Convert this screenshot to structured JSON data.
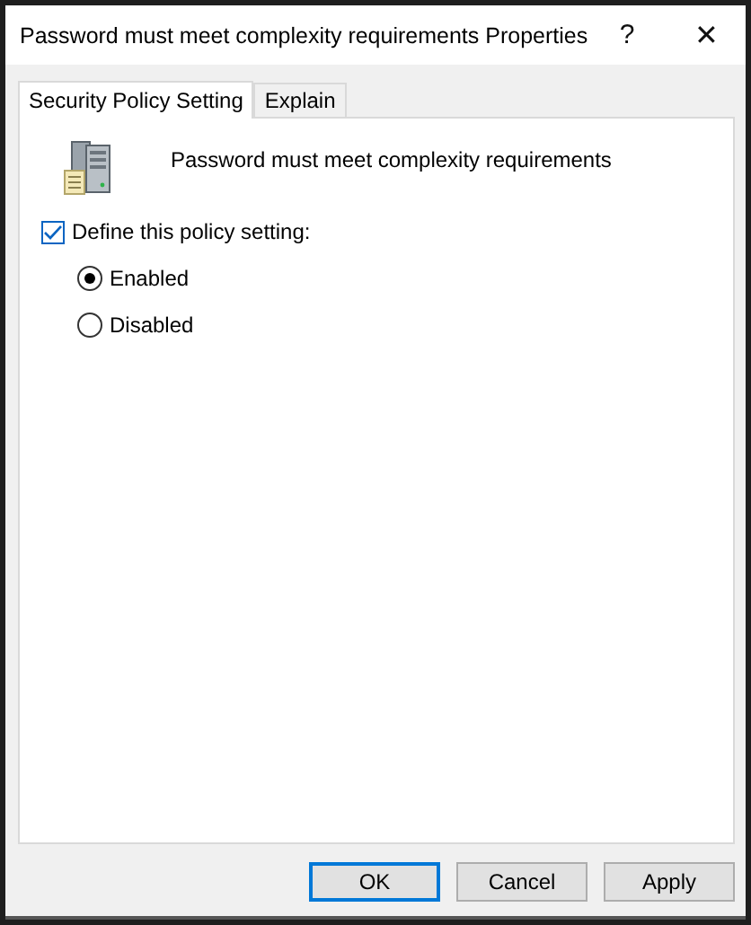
{
  "window": {
    "title": "Password must meet complexity requirements Properties",
    "help": "?",
    "close": "✕"
  },
  "tabs": [
    {
      "label": "Security Policy Setting",
      "selected": true
    },
    {
      "label": "Explain",
      "selected": false
    }
  ],
  "policy_name": "Password must meet complexity requirements",
  "define_setting": {
    "label": "Define this policy setting:",
    "checked": true
  },
  "options": [
    {
      "label": "Enabled",
      "selected": true
    },
    {
      "label": "Disabled",
      "selected": false
    }
  ],
  "buttons": [
    {
      "label": "OK",
      "default": true
    },
    {
      "label": "Cancel",
      "default": false
    },
    {
      "label": "Apply",
      "default": false
    }
  ]
}
